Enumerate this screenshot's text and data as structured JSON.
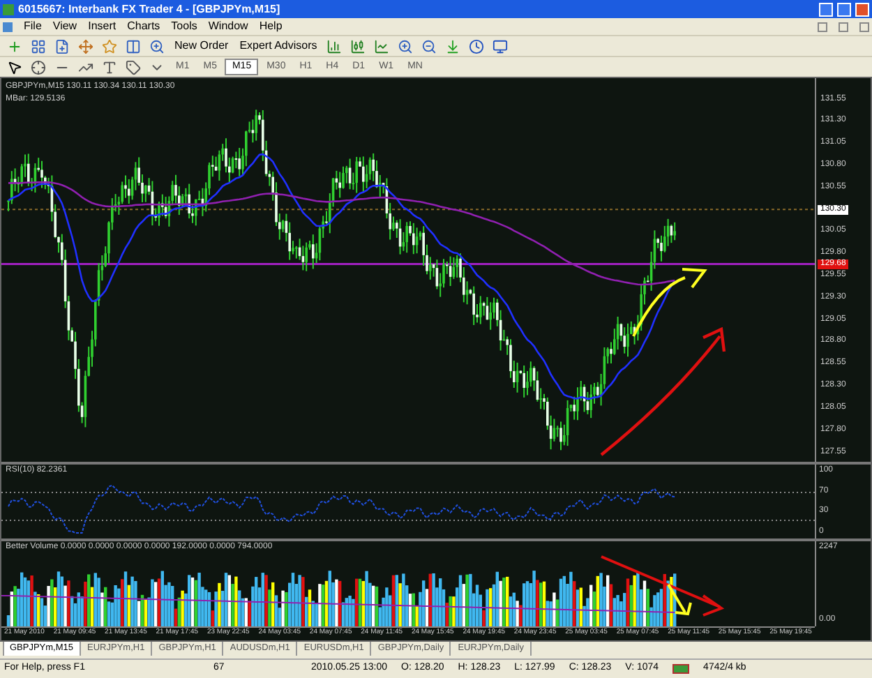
{
  "window": {
    "title": "6015667: Interbank FX Trader 4 - [GBPJPYm,M15]"
  },
  "menu": [
    "File",
    "View",
    "Insert",
    "Charts",
    "Tools",
    "Window",
    "Help"
  ],
  "toolbar": {
    "buttons": [
      {
        "label": "New Order"
      },
      {
        "label": "Expert Advisors"
      }
    ]
  },
  "timeframes": [
    {
      "label": "M1",
      "selected": false
    },
    {
      "label": "M5",
      "selected": false
    },
    {
      "label": "M15",
      "selected": true
    },
    {
      "label": "M30",
      "selected": false
    },
    {
      "label": "H1",
      "selected": false
    },
    {
      "label": "H4",
      "selected": false
    },
    {
      "label": "D1",
      "selected": false
    },
    {
      "label": "W1",
      "selected": false
    },
    {
      "label": "MN",
      "selected": false
    }
  ],
  "chart": {
    "header": "GBPJPYm,M15  130.11 130.34 130.11 130.30",
    "indicator": "MBar: 129.5136",
    "price_axis": [
      "131.55",
      "131.30",
      "131.05",
      "130.80",
      "130.55",
      "130.05",
      "129.80",
      "129.55",
      "129.30",
      "129.05",
      "128.80",
      "128.55",
      "128.30",
      "128.05",
      "127.80",
      "127.55"
    ],
    "price_markers": [
      {
        "kind": "bid",
        "label": "130.30"
      },
      {
        "kind": "line",
        "label": "129.68"
      }
    ]
  },
  "rsi": {
    "label": "RSI(10) 82.2361",
    "axis": [
      "100",
      "70",
      "30",
      "0"
    ]
  },
  "volume": {
    "label": "Better Volume 0.0000 0.0000 0.0000 0.0000 192.0000 0.0000 794.0000",
    "axis": [
      "2247",
      "0.00"
    ]
  },
  "time_axis": [
    "21 May 2010",
    "21 May 09:45",
    "21 May 13:45",
    "21 May 17:45",
    "23 May 22:45",
    "24 May 03:45",
    "24 May 07:45",
    "24 May 11:45",
    "24 May 15:45",
    "24 May 19:45",
    "24 May 23:45",
    "25 May 03:45",
    "25 May 07:45",
    "25 May 11:45",
    "25 May 15:45",
    "25 May 19:45"
  ],
  "tabs": [
    {
      "label": "GBPJPYm,M15",
      "selected": true
    },
    {
      "label": "EURJPYm,H1",
      "selected": false
    },
    {
      "label": "GBPJPYm,H1",
      "selected": false
    },
    {
      "label": "AUDUSDm,H1",
      "selected": false
    },
    {
      "label": "EURUSDm,H1",
      "selected": false
    },
    {
      "label": "GBPJPYm,Daily",
      "selected": false
    },
    {
      "label": "EURJPYm,Daily",
      "selected": false
    }
  ],
  "status_bar": {
    "help": "For Help, press F1",
    "profile": "67",
    "time": "2010.05.25 13:00",
    "open": "O: 128.20",
    "high": "H: 128.23",
    "low": "L: 127.99",
    "close": "C: 128.23",
    "volume": "V: 1074",
    "traffic": "4742/4 kb"
  }
}
